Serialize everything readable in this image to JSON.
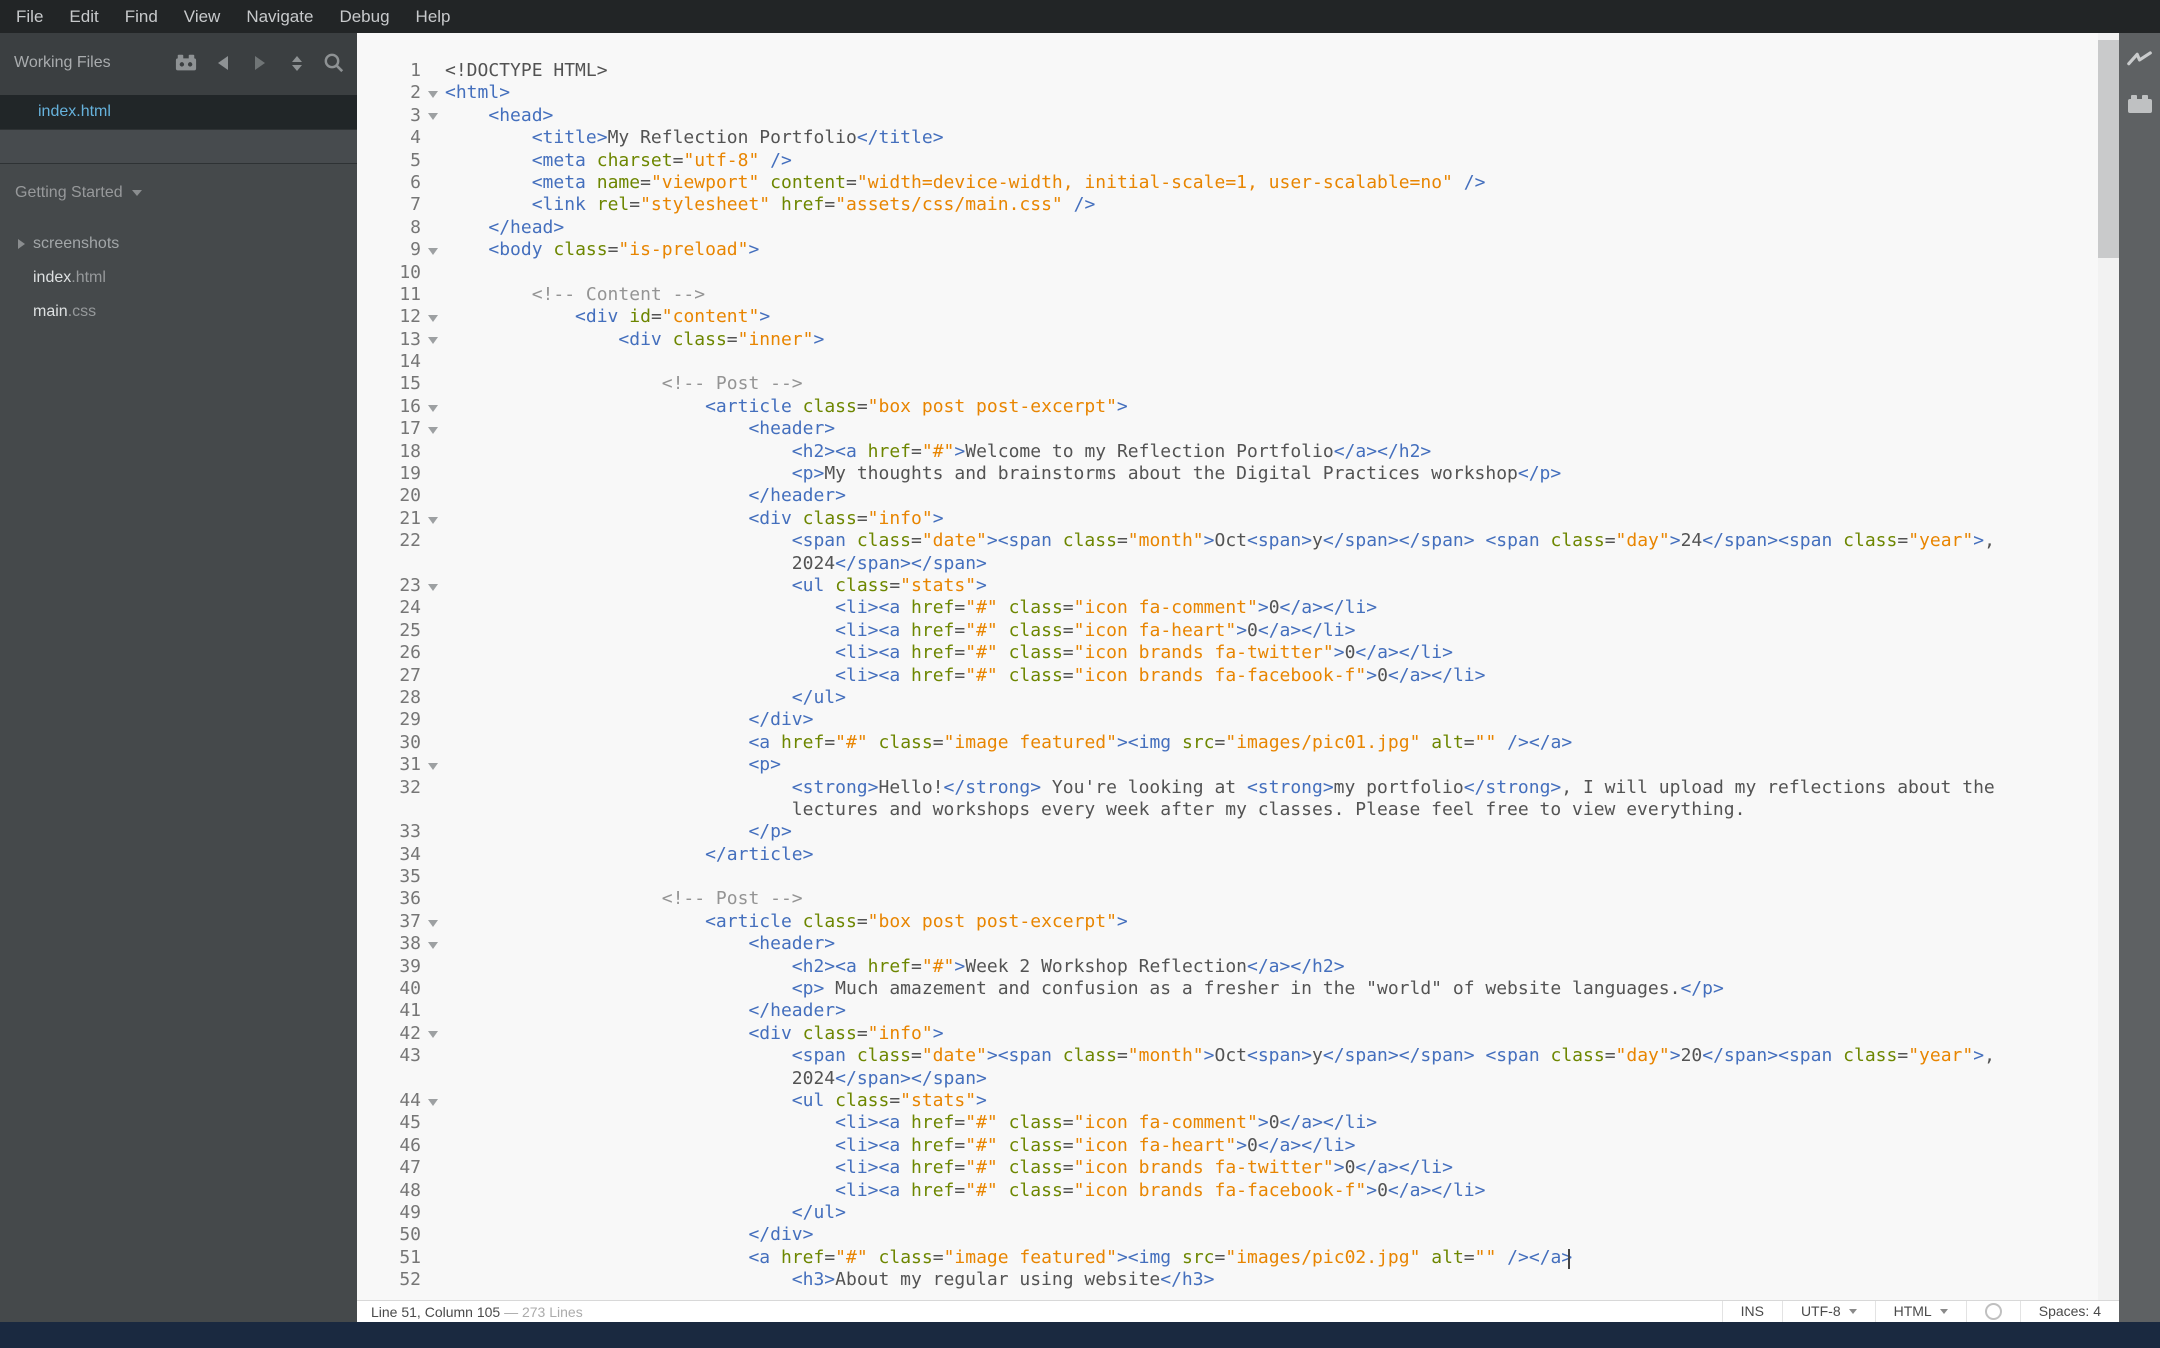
{
  "menu": {
    "items": [
      "File",
      "Edit",
      "Find",
      "View",
      "Navigate",
      "Debug",
      "Help"
    ]
  },
  "sidebar": {
    "working_files": {
      "label": "Working Files",
      "files": [
        {
          "name": "index.html",
          "active": true
        }
      ]
    },
    "project": {
      "label": "Getting Started"
    },
    "tree": [
      {
        "type": "folder",
        "label": "screenshots"
      },
      {
        "type": "file",
        "base": "index",
        "ext": ".html"
      },
      {
        "type": "file",
        "base": "main",
        "ext": ".css"
      }
    ]
  },
  "editor": {
    "fold_lines": [
      2,
      3,
      9,
      12,
      13,
      16,
      17,
      21,
      23,
      31,
      37,
      38,
      42,
      44
    ],
    "lines": [
      {
        "n": 1,
        "rows": [
          "<!DOCTYPE HTML>"
        ]
      },
      {
        "n": 2,
        "rows": [
          "<html>"
        ]
      },
      {
        "n": 3,
        "rows": [
          "    <head>"
        ]
      },
      {
        "n": 4,
        "rows": [
          "        <title>My Reflection Portfolio</title>"
        ]
      },
      {
        "n": 5,
        "rows": [
          "        <meta charset=\"utf-8\" />"
        ]
      },
      {
        "n": 6,
        "rows": [
          "        <meta name=\"viewport\" content=\"width=device-width, initial-scale=1, user-scalable=no\" />"
        ]
      },
      {
        "n": 7,
        "rows": [
          "        <link rel=\"stylesheet\" href=\"assets/css/main.css\" />"
        ]
      },
      {
        "n": 8,
        "rows": [
          "    </head>"
        ]
      },
      {
        "n": 9,
        "rows": [
          "    <body class=\"is-preload\">"
        ]
      },
      {
        "n": 10,
        "rows": [
          ""
        ]
      },
      {
        "n": 11,
        "rows": [
          "        <!-- Content -->"
        ]
      },
      {
        "n": 12,
        "rows": [
          "            <div id=\"content\">"
        ]
      },
      {
        "n": 13,
        "rows": [
          "                <div class=\"inner\">"
        ]
      },
      {
        "n": 14,
        "rows": [
          ""
        ]
      },
      {
        "n": 15,
        "rows": [
          "                    <!-- Post -->"
        ]
      },
      {
        "n": 16,
        "rows": [
          "                        <article class=\"box post post-excerpt\">"
        ]
      },
      {
        "n": 17,
        "rows": [
          "                            <header>"
        ]
      },
      {
        "n": 18,
        "rows": [
          "                                <h2><a href=\"#\">Welcome to my Reflection Portfolio</a></h2>"
        ]
      },
      {
        "n": 19,
        "rows": [
          "                                <p>My thoughts and brainstorms about the Digital Practices workshop</p>"
        ]
      },
      {
        "n": 20,
        "rows": [
          "                            </header>"
        ]
      },
      {
        "n": 21,
        "rows": [
          "                            <div class=\"info\">"
        ]
      },
      {
        "n": 22,
        "rows": [
          "                                <span class=\"date\"><span class=\"month\">Oct<span>y</span></span> <span class=\"day\">24</span><span class=\"year\">,",
          "                                2024</span></span>"
        ]
      },
      {
        "n": 23,
        "rows": [
          "                                <ul class=\"stats\">"
        ]
      },
      {
        "n": 24,
        "rows": [
          "                                    <li><a href=\"#\" class=\"icon fa-comment\">0</a></li>"
        ]
      },
      {
        "n": 25,
        "rows": [
          "                                    <li><a href=\"#\" class=\"icon fa-heart\">0</a></li>"
        ]
      },
      {
        "n": 26,
        "rows": [
          "                                    <li><a href=\"#\" class=\"icon brands fa-twitter\">0</a></li>"
        ]
      },
      {
        "n": 27,
        "rows": [
          "                                    <li><a href=\"#\" class=\"icon brands fa-facebook-f\">0</a></li>"
        ]
      },
      {
        "n": 28,
        "rows": [
          "                                </ul>"
        ]
      },
      {
        "n": 29,
        "rows": [
          "                            </div>"
        ]
      },
      {
        "n": 30,
        "rows": [
          "                            <a href=\"#\" class=\"image featured\"><img src=\"images/pic01.jpg\" alt=\"\" /></a>"
        ]
      },
      {
        "n": 31,
        "rows": [
          "                            <p>"
        ]
      },
      {
        "n": 32,
        "rows": [
          "                                <strong>Hello!</strong> You're looking at <strong>my portfolio</strong>, I will upload my reflections about the",
          "                                lectures and workshops every week after my classes. Please feel free to view everything."
        ]
      },
      {
        "n": 33,
        "rows": [
          "                            </p>"
        ]
      },
      {
        "n": 34,
        "rows": [
          "                        </article>"
        ]
      },
      {
        "n": 35,
        "rows": [
          ""
        ]
      },
      {
        "n": 36,
        "rows": [
          "                    <!-- Post -->"
        ]
      },
      {
        "n": 37,
        "rows": [
          "                        <article class=\"box post post-excerpt\">"
        ]
      },
      {
        "n": 38,
        "rows": [
          "                            <header>"
        ]
      },
      {
        "n": 39,
        "rows": [
          "                                <h2><a href=\"#\">Week 2 Workshop Reflection</a></h2>"
        ]
      },
      {
        "n": 40,
        "rows": [
          "                                <p> Much amazement and confusion as a fresher in the \"world\" of website languages.</p>"
        ]
      },
      {
        "n": 41,
        "rows": [
          "                            </header>"
        ]
      },
      {
        "n": 42,
        "rows": [
          "                            <div class=\"info\">"
        ]
      },
      {
        "n": 43,
        "rows": [
          "                                <span class=\"date\"><span class=\"month\">Oct<span>y</span></span> <span class=\"day\">20</span><span class=\"year\">,",
          "                                2024</span></span>"
        ]
      },
      {
        "n": 44,
        "rows": [
          "                                <ul class=\"stats\">"
        ]
      },
      {
        "n": 45,
        "rows": [
          "                                    <li><a href=\"#\" class=\"icon fa-comment\">0</a></li>"
        ]
      },
      {
        "n": 46,
        "rows": [
          "                                    <li><a href=\"#\" class=\"icon fa-heart\">0</a></li>"
        ]
      },
      {
        "n": 47,
        "rows": [
          "                                    <li><a href=\"#\" class=\"icon brands fa-twitter\">0</a></li>"
        ]
      },
      {
        "n": 48,
        "rows": [
          "                                    <li><a href=\"#\" class=\"icon brands fa-facebook-f\">0</a></li>"
        ]
      },
      {
        "n": 49,
        "rows": [
          "                                </ul>"
        ]
      },
      {
        "n": 50,
        "rows": [
          "                            </div>"
        ]
      },
      {
        "n": 51,
        "rows": [
          "                            <a href=\"#\" class=\"image featured\"><img src=\"images/pic02.jpg\" alt=\"\" /></a>"
        ]
      },
      {
        "n": 52,
        "rows": [
          "                                <h3>About my regular using website</h3>"
        ]
      }
    ]
  },
  "statusbar": {
    "cursor_position": "Line 51, Column 105",
    "line_count": "— 273 Lines",
    "insert_mode": "INS",
    "encoding": "UTF-8",
    "language": "HTML",
    "indent": "Spaces: 4"
  },
  "colors": {
    "tag": "#446fbd",
    "attribute": "#6d8600",
    "string": "#e88501",
    "text": "#535353",
    "comment": "#949494",
    "active_file": "#66b2dc"
  }
}
